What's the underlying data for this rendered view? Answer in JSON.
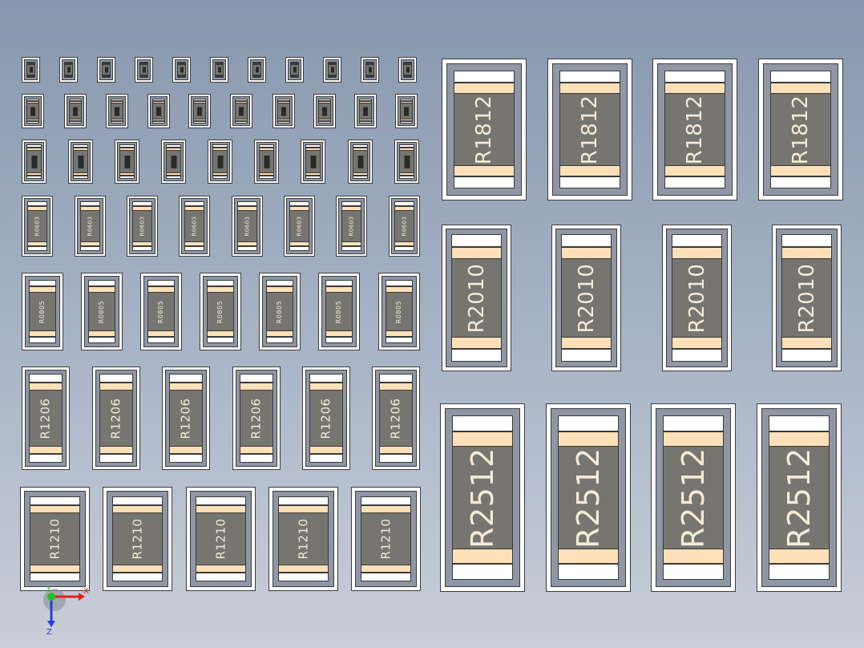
{
  "scene": {
    "title": "",
    "background_top": "#8797ad",
    "background_bottom": "#c9ced8",
    "colors": {
      "pad": "#ffffff",
      "frame": "#8f97a5",
      "resistor_body": "#76756f",
      "termination_band": "#fde0b8",
      "marking_text": "#f3ead8"
    }
  },
  "groups": [
    {
      "id": "r01005",
      "marking": "",
      "count": 11
    },
    {
      "id": "r0201",
      "marking": "",
      "count": 10
    },
    {
      "id": "r0402",
      "marking": "",
      "count": 9
    },
    {
      "id": "r0603",
      "marking": "R0603",
      "count": 8
    },
    {
      "id": "r0805",
      "marking": "R0805",
      "count": 7
    },
    {
      "id": "r1206",
      "marking": "R1206",
      "count": 6
    },
    {
      "id": "r1210",
      "marking": "R1210",
      "count": 5
    },
    {
      "id": "r1812",
      "marking": "R1812",
      "count": 4
    },
    {
      "id": "r2010",
      "marking": "R2010",
      "count": 4
    },
    {
      "id": "r2512",
      "marking": "R2512",
      "count": 4
    }
  ],
  "triad": {
    "x_label": "X",
    "y_label": "Y",
    "z_label": "Z",
    "x_color": "#e02020",
    "y_color": "#20c020",
    "z_color": "#2040e0"
  }
}
